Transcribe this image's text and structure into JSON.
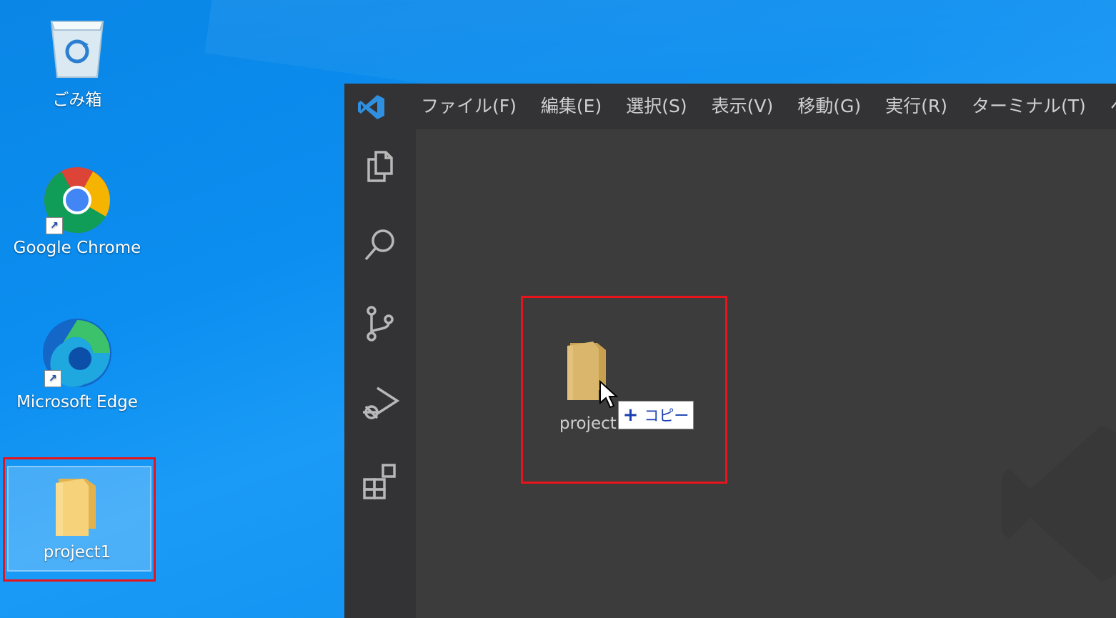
{
  "desktop": {
    "icons": [
      {
        "label": "ごみ箱",
        "icon": "recycle-bin-icon"
      },
      {
        "label": "Google Chrome",
        "icon": "chrome-icon"
      },
      {
        "label": "Microsoft Edge",
        "icon": "edge-icon"
      },
      {
        "label": "project1",
        "icon": "folder-icon"
      }
    ]
  },
  "vscode": {
    "menu": [
      "ファイル(F)",
      "編集(E)",
      "選択(S)",
      "表示(V)",
      "移動(G)",
      "実行(R)",
      "ターミナル(T)",
      "ヘルプ("
    ],
    "activity": [
      "explorer-icon",
      "search-icon",
      "source-control-icon",
      "run-debug-icon",
      "extensions-icon"
    ]
  },
  "drag": {
    "folder_label": "project",
    "tooltip_plus": "+",
    "tooltip_text": "コピー"
  },
  "colors": {
    "highlight": "#e8141b",
    "titlebar": "#333335",
    "editor": "#3c3c3c",
    "vscode_blue": "#2f8fe0",
    "folder": "#f0c96a"
  }
}
